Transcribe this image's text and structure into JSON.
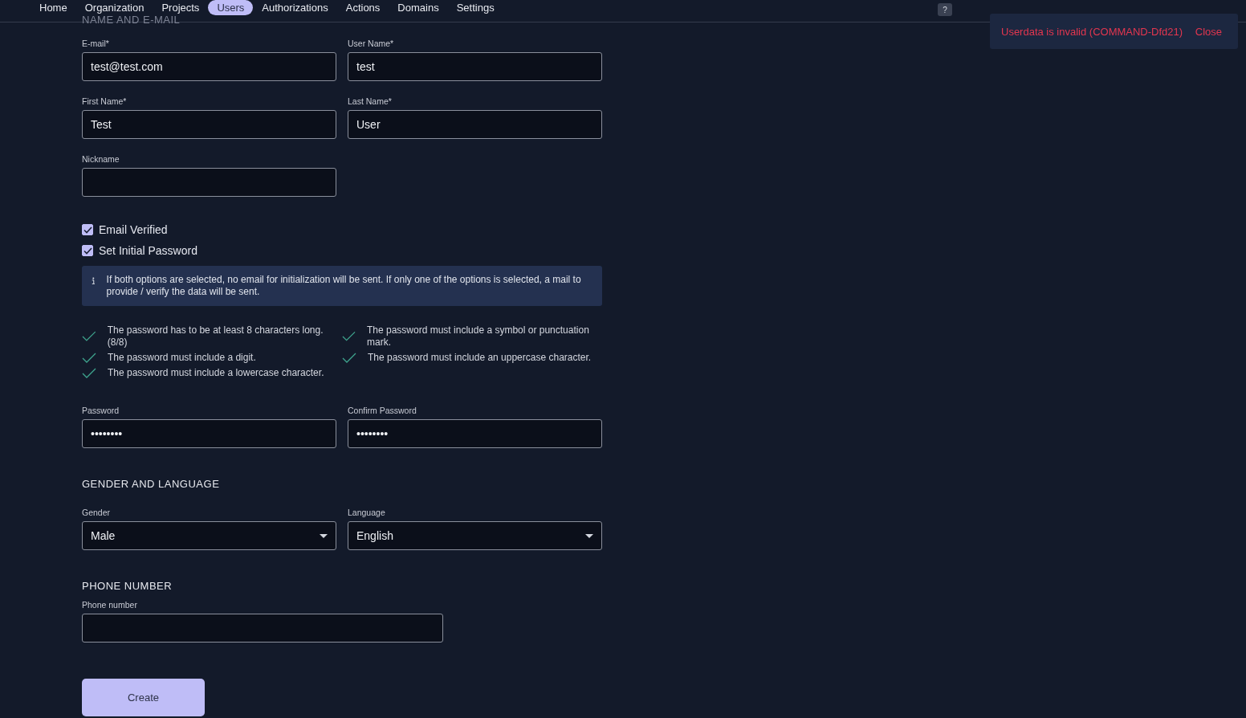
{
  "nav": {
    "items": [
      {
        "label": "Home",
        "selected": false
      },
      {
        "label": "Organization",
        "selected": false
      },
      {
        "label": "Projects",
        "selected": false
      },
      {
        "label": "Users",
        "selected": true
      },
      {
        "label": "Authorizations",
        "selected": false
      },
      {
        "label": "Actions",
        "selected": false
      },
      {
        "label": "Domains",
        "selected": false
      },
      {
        "label": "Settings",
        "selected": false
      }
    ],
    "help": "?"
  },
  "toast": {
    "message": "Userdata is invalid (COMMAND-Dfd21)",
    "action": "Close"
  },
  "name_section": {
    "title": "NAME AND E-MAIL",
    "fields": [
      {
        "label": "E-mail*",
        "value": "test@test.com"
      },
      {
        "label": "User Name*",
        "value": "test"
      },
      {
        "label": "First Name*",
        "value": "Test"
      },
      {
        "label": "Last Name*",
        "value": "User"
      },
      {
        "label": "Nickname"
      }
    ]
  },
  "checkboxes": [
    {
      "label": "Email Verified",
      "checked": true
    },
    {
      "label": "Set Initial Password",
      "checked": true
    }
  ],
  "info": "If both options are selected, no email for initialization will be sent. If only one of the options is selected, a mail to provide / verify the data will be sent.",
  "requirements": [
    {
      "text": "The password has to be at least 8 characters long. (8/8)",
      "met": true
    },
    {
      "text": "The password must include a symbol or punctuation mark.",
      "met": true
    },
    {
      "text": "The password must include a digit.",
      "met": true
    },
    {
      "text": "The password must include an uppercase character.",
      "met": true
    },
    {
      "text": "The password must include a lowercase character.",
      "met": true
    }
  ],
  "password_fields": [
    {
      "label": "Password",
      "value": "••••••••"
    },
    {
      "label": "Confirm Password",
      "value": "••••••••"
    }
  ],
  "gender_section": {
    "title": "GENDER AND LANGUAGE",
    "selects": [
      {
        "label": "Gender",
        "value": "Male"
      },
      {
        "label": "Language",
        "value": "English"
      }
    ]
  },
  "phone_section": {
    "title": "PHONE NUMBER",
    "field": {
      "label": "Phone number"
    }
  },
  "submit": "Create"
}
